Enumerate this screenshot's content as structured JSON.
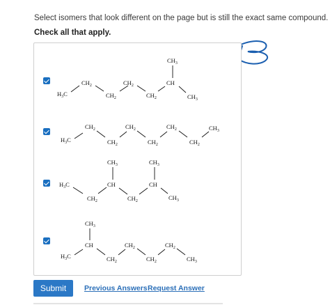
{
  "question_text": "Select isomers that look different on the page but is still the exact same compound.",
  "instruction": "Check all that apply.",
  "options": [
    {
      "checked": true
    },
    {
      "checked": true
    },
    {
      "checked": true
    },
    {
      "checked": true
    }
  ],
  "labels": {
    "ch3": "CH3",
    "ch2": "CH2",
    "ch": "CH",
    "h3c": "H3C"
  },
  "annotation_text": "B",
  "footer": {
    "submit_label": "Submit",
    "previous_answers_label": "Previous Answers",
    "request_answer_label": "Request Answer"
  },
  "colors": {
    "accent": "#2b78c6",
    "link": "#2b6fb8",
    "annotation": "#1b5fb0"
  }
}
